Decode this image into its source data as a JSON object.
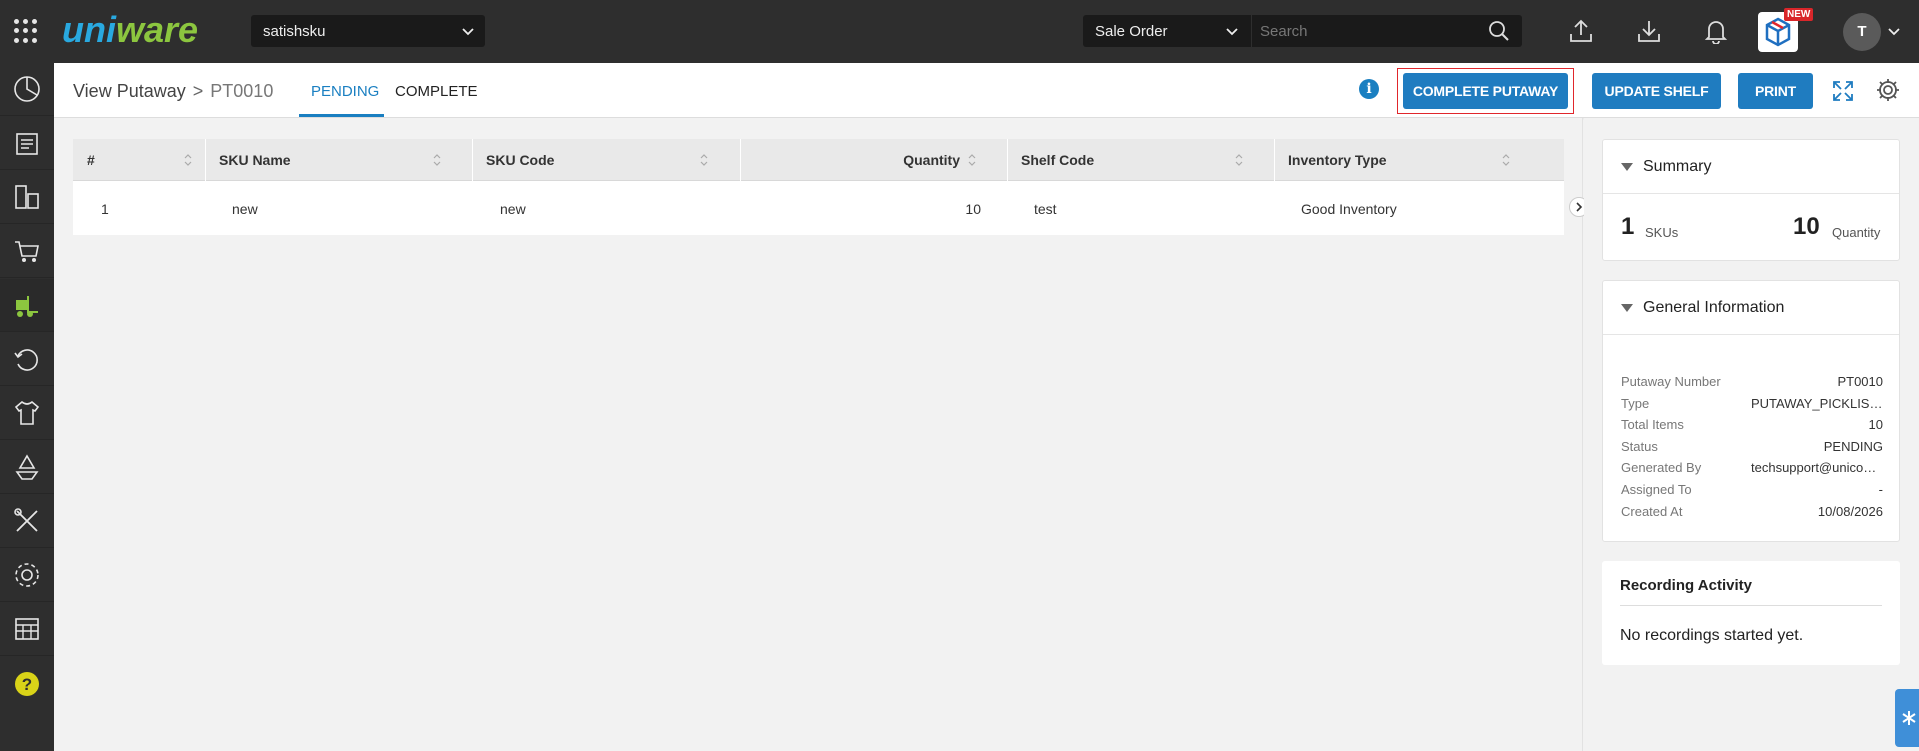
{
  "topbar": {
    "logo_text": "uniware",
    "facility": "satishsku",
    "search_type": "Sale Order",
    "search_placeholder": "Search",
    "new_badge": "NEW",
    "avatar_initial": "T"
  },
  "sidebar": {
    "items": [
      "dashboard-icon",
      "orders-icon",
      "purchase-icon",
      "cart-icon",
      "forklift-icon",
      "returns-icon",
      "shirt-icon",
      "recycle-icon",
      "tools-icon",
      "settings-icon",
      "table-icon",
      "help-icon"
    ]
  },
  "header": {
    "breadcrumb_root": "View Putaway",
    "breadcrumb_sep": ">",
    "breadcrumb_current": "PT0010",
    "tab_pending": "PENDING",
    "tab_complete": "COMPLETE",
    "info_label": "i",
    "btn_complete_putaway": "COMPLETE PUTAWAY",
    "btn_update_shelf": "UPDATE SHELF",
    "btn_print": "PRINT"
  },
  "table": {
    "columns": [
      "#",
      "SKU Name",
      "SKU Code",
      "Quantity",
      "Shelf Code",
      "Inventory Type"
    ],
    "rows": [
      {
        "idx": "1",
        "sku_name": "new",
        "sku_code": "new",
        "quantity": "10",
        "shelf_code": "test",
        "inventory_type": "Good Inventory"
      }
    ]
  },
  "summary": {
    "title": "Summary",
    "skus_count": "1",
    "skus_label": "SKUs",
    "qty_count": "10",
    "qty_label": "Quantity"
  },
  "general_info": {
    "title": "General Information",
    "rows": [
      {
        "k": "Putaway Number",
        "v": "PT0010"
      },
      {
        "k": "Type",
        "v": "PUTAWAY_PICKLIST_ITEM"
      },
      {
        "k": "Total Items",
        "v": "10"
      },
      {
        "k": "Status",
        "v": "PENDING"
      },
      {
        "k": "Generated By",
        "v": "techsupport@unicommerce.com"
      },
      {
        "k": "Assigned To",
        "v": "-"
      },
      {
        "k": "Created At",
        "v": "10/08/2026"
      }
    ]
  },
  "recording": {
    "title": "Recording Activity",
    "text": "No recordings started yet."
  },
  "colors": {
    "accent": "#1f7cc0",
    "topbar": "#2e2e2e",
    "highlight": "#e0262b",
    "logo_blue": "#29a9e0",
    "logo_green": "#8cc63f"
  }
}
